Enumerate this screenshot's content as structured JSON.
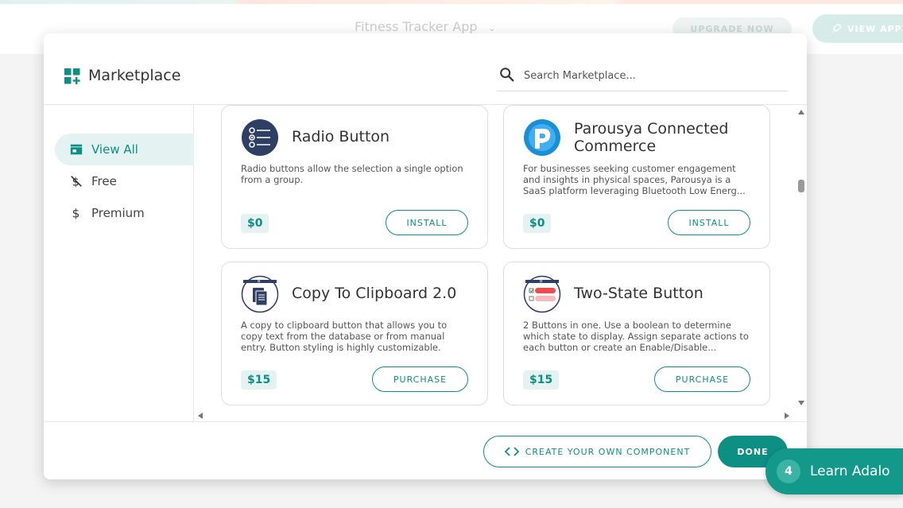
{
  "background": {
    "app_name": "Fitness Tracker App",
    "upgrade_label": "UPGRADE NOW",
    "view_app_label": "VIEW APP"
  },
  "modal": {
    "title": "Marketplace",
    "search": {
      "placeholder": "Search Marketplace...",
      "value": ""
    }
  },
  "sidebar": {
    "items": [
      {
        "label": "View All",
        "icon": "store-icon",
        "active": true
      },
      {
        "label": "Free",
        "icon": "no-dollar-icon",
        "active": false
      },
      {
        "label": "Premium",
        "icon": "dollar-icon",
        "active": false
      }
    ]
  },
  "cards": [
    {
      "title": "Radio Button",
      "description": "Radio buttons allow the selection a single option from a group.",
      "price": "$0",
      "action": "INSTALL",
      "icon": "radio-list-icon"
    },
    {
      "title": "Parousya Connected Commerce",
      "description": "For businesses seeking customer engagement and insights in physical spaces, Parousya is a SaaS platform leveraging Bluetooth Low Energ...",
      "price": "$0",
      "action": "INSTALL",
      "icon": "parousya-logo-icon"
    },
    {
      "title": "Copy To Clipboard 2.0",
      "description": "A copy to clipboard button that allows you to copy text from the database or from manual entry. Button styling is highly customizable.",
      "price": "$15",
      "action": "PURCHASE",
      "icon": "clipboard-icon"
    },
    {
      "title": "Two-State Button",
      "description": "2 Buttons in one. Use a boolean to determine which state to display. Assign separate actions to each button or create an Enable/Disable...",
      "price": "$15",
      "action": "PURCHASE",
      "icon": "toggle-buttons-icon"
    }
  ],
  "footer": {
    "create_label": "CREATE YOUR OWN COMPONENT",
    "done_label": "DONE"
  },
  "learn": {
    "count": "4",
    "label": "Learn Adalo"
  },
  "colors": {
    "accent": "#0e8f83",
    "accent_light": "#e4f3f1",
    "learn_bg": "#12998a"
  }
}
